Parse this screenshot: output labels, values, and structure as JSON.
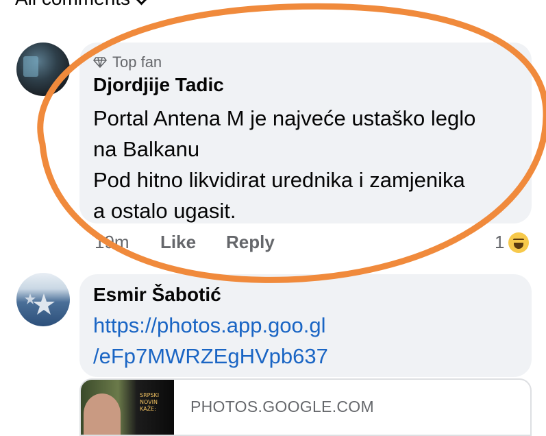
{
  "header": {
    "label": "All comments"
  },
  "comments": [
    {
      "badge": "Top fan",
      "author": "Djordjije Tadic",
      "lines": [
        "Portal Antena M je najveće ustaško leglo",
        "na Balkanu",
        "Pod hitno likvidirat urednika i zamjenika",
        "a ostalo ugasit."
      ],
      "time": "19m",
      "like_label": "Like",
      "reply_label": "Reply",
      "reaction_count": "1",
      "reaction_icon": "haha-emoji-icon"
    },
    {
      "author": "Esmir Šabotić",
      "link_lines": [
        "https://photos.app.goo.gl",
        "/eFp7MWRZEgHVpb637"
      ],
      "preview": {
        "thumb_text": "SRPSKI NOVIN\nKAŽE:",
        "domain": "PHOTOS.GOOGLE.COM"
      }
    }
  ],
  "annotation": {
    "color": "#f08a3c",
    "shape": "ellipse"
  }
}
